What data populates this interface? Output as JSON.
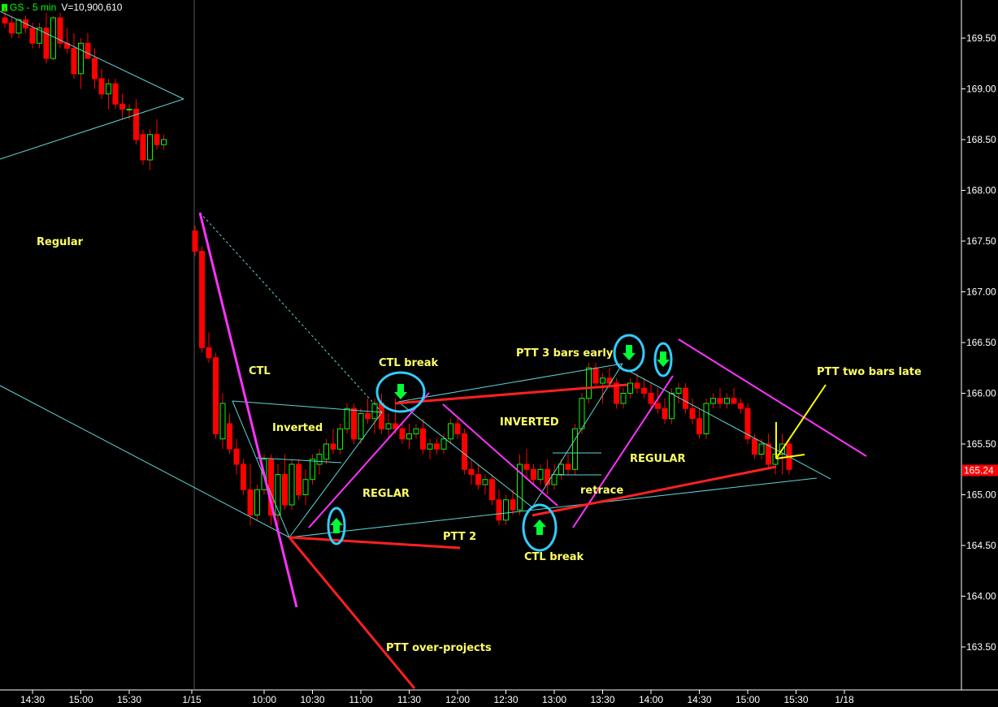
{
  "header": {
    "symbol": "GS - 5 min",
    "volume": "V=10,900,610"
  },
  "colors": {
    "up": "#00ff00",
    "down": "#ff0000",
    "wick": "#ff0000",
    "cyan": "#5fd3d3",
    "magenta": "#ff33ff",
    "red": "#ff2020",
    "yellow": "#ffff00",
    "label": "#ffff66",
    "axis": "#ffffff",
    "circle": "#33ccff",
    "arrow": "#00ff33",
    "lastPriceBg": "#ff0000"
  },
  "chart_data": {
    "type": "candlestick",
    "timeframe": "5 min",
    "ylim": [
      163.2,
      170.15
    ],
    "yticks": [
      "169.50",
      "169.00",
      "168.50",
      "168.00",
      "167.50",
      "167.00",
      "166.50",
      "166.00",
      "165.50",
      "165.00",
      "164.50",
      "164.00",
      "163.50"
    ],
    "xticks": [
      "14:30",
      "15:00",
      "15:30",
      "1/15",
      "10:00",
      "10:30",
      "11:00",
      "11:30",
      "12:00",
      "12:30",
      "13:00",
      "13:30",
      "14:00",
      "14:30",
      "15:00",
      "15:30",
      "1/18"
    ],
    "last_price": "165.24",
    "candles": [
      [
        169.7,
        169.8,
        169.6,
        169.65
      ],
      [
        169.65,
        169.72,
        169.5,
        169.55
      ],
      [
        169.55,
        169.7,
        169.5,
        169.68
      ],
      [
        169.68,
        169.72,
        169.55,
        169.6
      ],
      [
        169.6,
        169.65,
        169.4,
        169.45
      ],
      [
        169.45,
        169.65,
        169.4,
        169.6
      ],
      [
        169.6,
        169.75,
        169.25,
        169.3
      ],
      [
        169.3,
        169.72,
        169.28,
        169.7
      ],
      [
        169.7,
        169.75,
        169.4,
        169.45
      ],
      [
        169.45,
        169.6,
        169.35,
        169.4
      ],
      [
        169.4,
        169.55,
        169.1,
        169.15
      ],
      [
        169.15,
        169.5,
        169.0,
        169.45
      ],
      [
        169.45,
        169.55,
        169.3,
        169.3
      ],
      [
        169.3,
        169.4,
        169.0,
        169.1
      ],
      [
        169.1,
        169.2,
        168.9,
        168.95
      ],
      [
        168.95,
        169.1,
        168.8,
        169.05
      ],
      [
        169.05,
        169.1,
        168.8,
        168.85
      ],
      [
        168.85,
        168.95,
        168.7,
        168.8
      ],
      [
        168.8,
        168.85,
        168.7,
        168.8
      ],
      [
        168.8,
        168.9,
        168.45,
        168.5
      ],
      [
        168.55,
        168.6,
        168.25,
        168.3
      ],
      [
        168.3,
        168.6,
        168.2,
        168.55
      ],
      [
        168.55,
        168.7,
        168.4,
        168.45
      ],
      [
        168.45,
        168.55,
        168.4,
        168.5
      ],
      [
        167.6,
        167.65,
        167.35,
        167.4
      ],
      [
        167.4,
        167.45,
        166.4,
        166.45
      ],
      [
        166.45,
        166.6,
        166.3,
        166.35
      ],
      [
        166.35,
        166.4,
        165.55,
        165.6
      ],
      [
        165.55,
        166.0,
        165.45,
        165.9
      ],
      [
        165.7,
        165.8,
        165.4,
        165.45
      ],
      [
        165.45,
        165.55,
        165.2,
        165.3
      ],
      [
        165.3,
        165.35,
        165.0,
        165.05
      ],
      [
        165.05,
        165.3,
        164.7,
        164.8
      ],
      [
        164.8,
        165.1,
        164.75,
        165.05
      ],
      [
        165.05,
        165.4,
        165.0,
        165.35
      ],
      [
        165.35,
        165.4,
        164.7,
        164.8
      ],
      [
        164.8,
        165.3,
        164.7,
        165.2
      ],
      [
        165.2,
        165.4,
        164.85,
        164.9
      ],
      [
        164.9,
        165.35,
        164.85,
        165.3
      ],
      [
        165.3,
        165.35,
        164.95,
        165.0
      ],
      [
        165.0,
        165.25,
        164.9,
        165.15
      ],
      [
        165.15,
        165.4,
        165.1,
        165.35
      ],
      [
        165.3,
        165.45,
        165.2,
        165.4
      ],
      [
        165.35,
        165.55,
        165.3,
        165.5
      ],
      [
        165.5,
        165.65,
        165.4,
        165.45
      ],
      [
        165.45,
        165.7,
        165.4,
        165.65
      ],
      [
        165.65,
        165.9,
        165.6,
        165.85
      ],
      [
        165.85,
        165.9,
        165.5,
        165.55
      ],
      [
        165.55,
        165.85,
        165.5,
        165.8
      ],
      [
        165.8,
        165.95,
        165.7,
        165.75
      ],
      [
        165.75,
        165.95,
        165.6,
        165.9
      ],
      [
        165.9,
        166.0,
        165.6,
        165.65
      ],
      [
        165.65,
        165.8,
        165.55,
        165.7
      ],
      [
        165.7,
        165.95,
        165.6,
        165.65
      ],
      [
        165.65,
        165.7,
        165.5,
        165.55
      ],
      [
        165.55,
        165.7,
        165.45,
        165.6
      ],
      [
        165.6,
        165.7,
        165.55,
        165.65
      ],
      [
        165.65,
        165.75,
        165.4,
        165.45
      ],
      [
        165.45,
        165.55,
        165.35,
        165.5
      ],
      [
        165.5,
        165.55,
        165.4,
        165.45
      ],
      [
        165.45,
        165.6,
        165.4,
        165.55
      ],
      [
        165.55,
        165.75,
        165.5,
        165.7
      ],
      [
        165.7,
        165.75,
        165.55,
        165.6
      ],
      [
        165.6,
        165.65,
        165.2,
        165.25
      ],
      [
        165.25,
        165.35,
        165.1,
        165.2
      ],
      [
        165.2,
        165.3,
        165.05,
        165.1
      ],
      [
        165.1,
        165.2,
        165.0,
        165.15
      ],
      [
        165.15,
        165.2,
        164.9,
        164.95
      ],
      [
        164.95,
        165.05,
        164.7,
        164.75
      ],
      [
        164.75,
        165.0,
        164.7,
        164.95
      ],
      [
        164.95,
        165.05,
        164.8,
        164.85
      ],
      [
        164.85,
        165.4,
        164.8,
        165.3
      ],
      [
        165.3,
        165.45,
        165.15,
        165.25
      ],
      [
        165.25,
        165.3,
        165.1,
        165.15
      ],
      [
        165.15,
        165.3,
        165.1,
        165.25
      ],
      [
        165.25,
        165.35,
        165.0,
        165.1
      ],
      [
        165.1,
        165.3,
        165.05,
        165.2
      ],
      [
        165.2,
        165.35,
        165.15,
        165.3
      ],
      [
        165.3,
        165.4,
        165.2,
        165.25
      ],
      [
        165.25,
        165.7,
        165.2,
        165.65
      ],
      [
        165.65,
        166.0,
        165.6,
        165.95
      ],
      [
        165.95,
        166.3,
        165.9,
        166.25
      ],
      [
        166.25,
        166.3,
        166.05,
        166.1
      ],
      [
        166.1,
        166.2,
        165.9,
        166.15
      ],
      [
        166.15,
        166.25,
        166.05,
        166.1
      ],
      [
        166.1,
        166.15,
        165.85,
        165.9
      ],
      [
        165.9,
        166.05,
        165.85,
        166.0
      ],
      [
        166.0,
        166.15,
        165.95,
        166.1
      ],
      [
        166.1,
        166.2,
        166.0,
        166.05
      ],
      [
        166.05,
        166.15,
        165.95,
        166.0
      ],
      [
        166.0,
        166.1,
        165.85,
        165.9
      ],
      [
        165.9,
        166.05,
        165.8,
        165.85
      ],
      [
        165.85,
        165.95,
        165.7,
        165.75
      ],
      [
        165.75,
        166.05,
        165.7,
        166.0
      ],
      [
        166.0,
        166.1,
        165.9,
        166.05
      ],
      [
        166.05,
        166.1,
        165.8,
        165.85
      ],
      [
        165.85,
        165.95,
        165.7,
        165.75
      ],
      [
        165.75,
        165.85,
        165.55,
        165.6
      ],
      [
        165.6,
        165.95,
        165.55,
        165.9
      ],
      [
        165.9,
        166.0,
        165.85,
        165.95
      ],
      [
        165.95,
        166.05,
        165.85,
        165.9
      ],
      [
        165.9,
        166.0,
        165.85,
        165.95
      ],
      [
        165.95,
        166.05,
        165.9,
        165.9
      ],
      [
        165.9,
        165.95,
        165.8,
        165.85
      ],
      [
        165.85,
        165.9,
        165.5,
        165.55
      ],
      [
        165.55,
        165.6,
        165.35,
        165.4
      ],
      [
        165.4,
        165.55,
        165.35,
        165.5
      ],
      [
        165.5,
        165.6,
        165.25,
        165.3
      ],
      [
        165.3,
        165.45,
        165.2,
        165.4
      ],
      [
        165.4,
        165.6,
        165.2,
        165.5
      ],
      [
        165.5,
        165.55,
        165.2,
        165.25
      ]
    ],
    "annotations": {
      "labels": [
        {
          "text": "Regular",
          "price": 167.5,
          "bar": 3
        },
        {
          "text": "CTL",
          "price": 166.7,
          "bar": 34
        },
        {
          "text": "Inverted",
          "price": 165.65,
          "bar": 38
        },
        {
          "text": "CTL break",
          "price": 166.3,
          "bar": 56
        },
        {
          "text": "REGLAR",
          "price": 165.05,
          "bar": 51
        },
        {
          "text": "PTT 2",
          "price": 164.45,
          "bar": 62
        },
        {
          "text": "PTT over-projects",
          "price": 163.5,
          "bar": 54
        },
        {
          "text": "PTT 3 bars early",
          "price": 166.45,
          "bar": 72
        },
        {
          "text": "INVERTED",
          "price": 165.7,
          "bar": 69
        },
        {
          "text": "CTL break",
          "price": 164.4,
          "bar": 73
        },
        {
          "text": "retrace",
          "price": 165.05,
          "bar": 82
        },
        {
          "text": "REGULAR",
          "price": 165.45,
          "bar": 88
        },
        {
          "text": "PTT two bars late",
          "price": 166.2,
          "bar": 116
        }
      ]
    }
  }
}
